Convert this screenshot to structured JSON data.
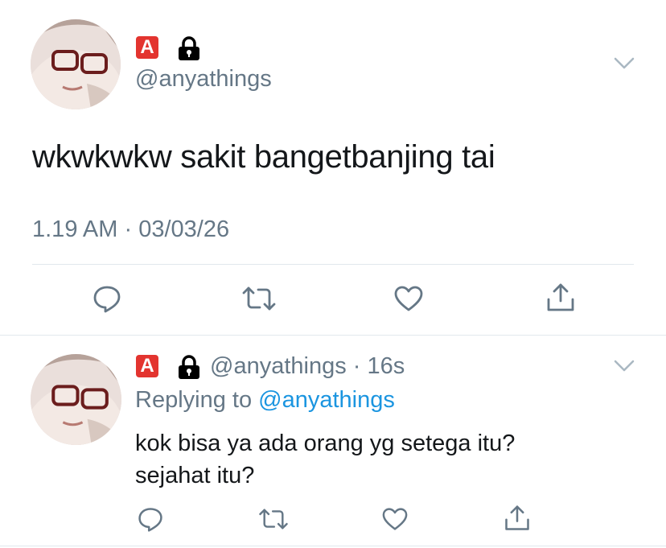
{
  "colors": {
    "link": "#1b95e0",
    "secondary": "#657786",
    "text": "#14171a",
    "badge": "#e3342f"
  },
  "main_tweet": {
    "badge_letter": "A",
    "handle": "@anyathings",
    "text": "wkwkwkw sakit bangetbanjing tai",
    "time": "1.19 AM",
    "separator": "·",
    "date": "03/03/26",
    "icons": [
      "chevron-down-icon",
      "lock-icon",
      "reply-icon",
      "retweet-icon",
      "like-icon",
      "share-icon"
    ]
  },
  "reply_tweet": {
    "badge_letter": "A",
    "handle": "@anyathings",
    "separator": "·",
    "age": "16s",
    "replying_prefix": "Replying to",
    "replying_handle": "@anyathings",
    "text_line1": "kok bisa ya ada orang yg setega itu?",
    "text_line2": "sejahat itu?"
  }
}
